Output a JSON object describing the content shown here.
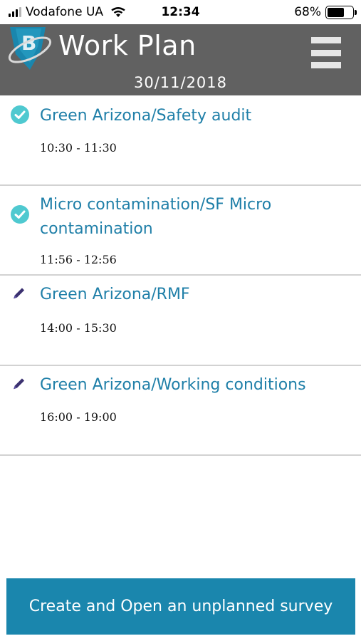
{
  "status_bar": {
    "carrier": "Vodafone UA",
    "time": "12:34",
    "battery_percent": "68%",
    "battery_level": 0.68
  },
  "header": {
    "title": "Work Plan",
    "date": "30/11/2018",
    "menu_icon": "hamburger-menu-icon"
  },
  "plan_items": [
    {
      "title": "Green Arizona/Safety audit",
      "time": "10:30 - 11:30",
      "status_icon": "check-circle-icon"
    },
    {
      "title": "Micro contamination/SF Micro contamination",
      "time": "11:56 - 12:56",
      "status_icon": "check-circle-icon"
    },
    {
      "title": "Green Arizona/RMF",
      "time": "14:00 - 15:30",
      "status_icon": "pencil-icon"
    },
    {
      "title": "Green Arizona/Working conditions",
      "time": "16:00 - 19:00",
      "status_icon": "pencil-icon"
    }
  ],
  "create_button": {
    "label": "Create and Open an unplanned survey"
  },
  "colors": {
    "header_bg": "#616161",
    "accent": "#1a86ad",
    "title_text": "#1f7fa8",
    "check": "#4fc9d0",
    "pencil": "#3b3170"
  }
}
